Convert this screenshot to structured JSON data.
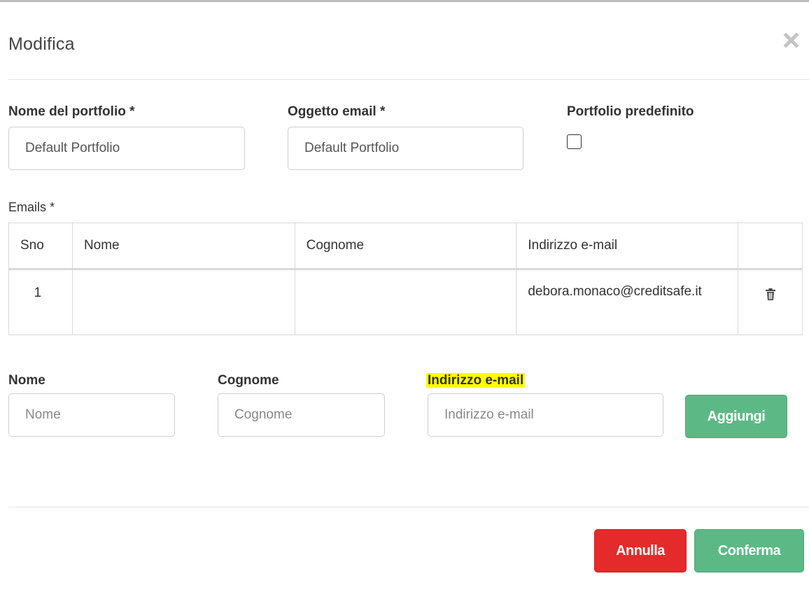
{
  "modal": {
    "title": "Modifica"
  },
  "form": {
    "portfolio_name_label": "Nome del portfolio *",
    "portfolio_name_value": "Default Portfolio",
    "email_subject_label": "Oggetto email *",
    "email_subject_value": "Default Portfolio",
    "default_portfolio_label": "Portfolio predefinito",
    "default_portfolio_checked": false
  },
  "emails": {
    "label": "Emails *",
    "columns": [
      "Sno",
      "Nome",
      "Cognome",
      "Indirizzo e-mail",
      ""
    ],
    "rows": [
      {
        "sno": "1",
        "nome": "",
        "cognome": "",
        "email": "debora.monaco@creditsafe.it"
      }
    ]
  },
  "add_email": {
    "nome_label": "Nome",
    "nome_placeholder": "Nome",
    "cognome_label": "Cognome",
    "cognome_placeholder": "Cognome",
    "email_label": "Indirizzo e-mail",
    "email_placeholder": "Indirizzo e-mail",
    "add_button": "Aggiungi"
  },
  "footer": {
    "cancel_button": "Annulla",
    "confirm_button": "Conferma"
  },
  "colors": {
    "green_button": "#5cb985",
    "red_button": "#e42a2a",
    "highlight": "#ffff00"
  },
  "icons": {
    "close": "close-icon",
    "delete": "trash-icon",
    "checkbox": "checkbox"
  }
}
